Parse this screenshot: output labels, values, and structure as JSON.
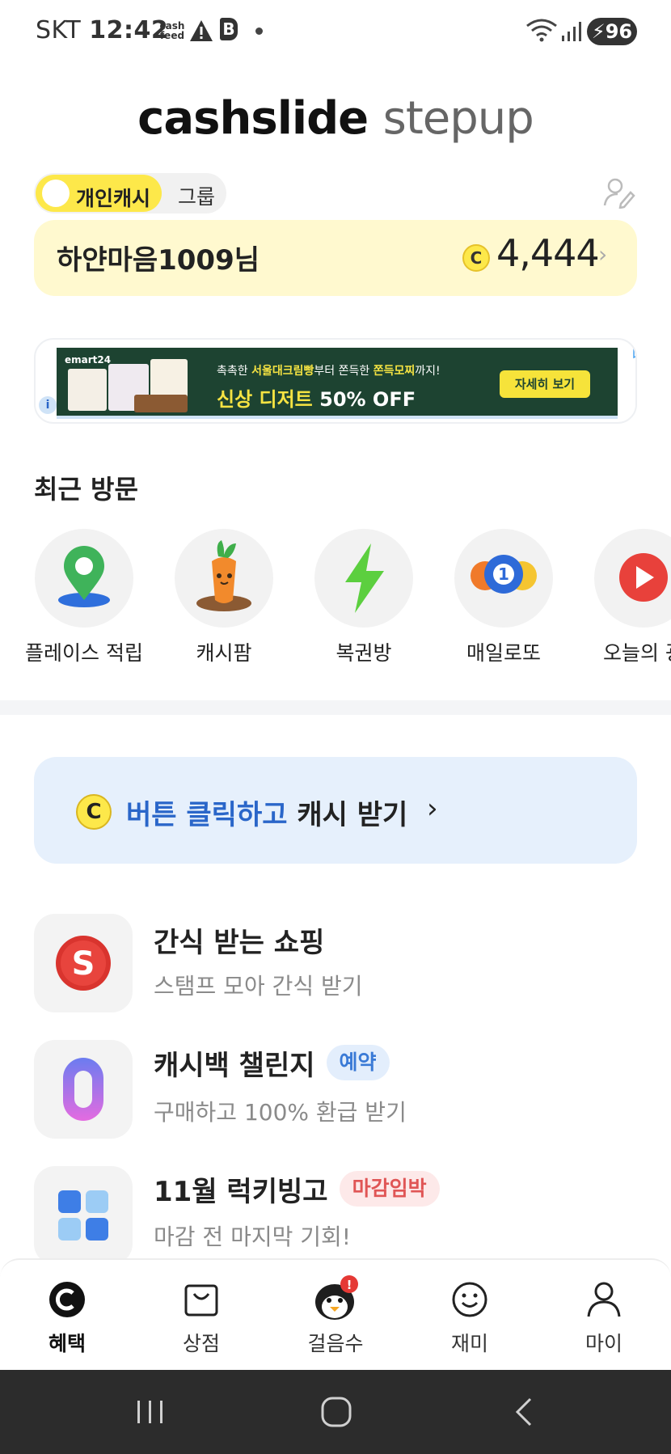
{
  "status_bar": {
    "carrier": "SKT",
    "time": "12:42",
    "cashfeed_line1": "cash",
    "cashfeed_line2": "feed",
    "b_icon": "B",
    "battery": "96"
  },
  "logo": {
    "part1": "cashslide",
    "part2": "stepup"
  },
  "toggle": {
    "personal": "개인캐시",
    "group": "그룹"
  },
  "cash_card": {
    "name": "하얀마음1009님",
    "coin": "C",
    "amount": "4,444"
  },
  "ad": {
    "brand": "emart24",
    "line1_a": "촉촉한 ",
    "line1_b": "서울대크림빵",
    "line1_c": "부터 쫀득한 ",
    "line1_d": "쫀득모찌",
    "line1_e": "까지!",
    "line2_a": "신상 디저트",
    "line2_b": " 50% OFF",
    "button": "자세히 보기",
    "info": "i"
  },
  "recent": {
    "title": "최근 방문",
    "items": [
      {
        "label": "플레이스 적립",
        "icon": "map-pin-icon"
      },
      {
        "label": "캐시팜",
        "icon": "carrot-icon"
      },
      {
        "label": "복권방",
        "icon": "lightning-icon"
      },
      {
        "label": "매일로또",
        "icon": "lotto-balls-icon",
        "ball": "1"
      },
      {
        "label": "오늘의 광",
        "icon": "play-icon"
      }
    ]
  },
  "cash_button": {
    "coin": "C",
    "blue": "버튼 클릭하고",
    "dark": " 캐시 받기",
    "chevron": "›"
  },
  "list": [
    {
      "title": "간식 받는 쇼핑",
      "sub": "스탬프 모아 간식 받기",
      "icon_letter": "S"
    },
    {
      "title": "캐시백 챌린지",
      "badge": "예약",
      "sub": "구매하고 100% 환급 받기",
      "icon_letter": "0"
    },
    {
      "title": "11월 럭키빙고",
      "badge": "마감임박",
      "sub": "마감 전 마지막 기회!"
    }
  ],
  "nav": [
    {
      "label": "혜택",
      "icon": "coin-c-icon"
    },
    {
      "label": "상점",
      "icon": "shopping-bag-icon"
    },
    {
      "label": "걸음수",
      "icon": "penguin-icon",
      "alert": "!"
    },
    {
      "label": "재미",
      "icon": "smile-icon"
    },
    {
      "label": "마이",
      "icon": "person-icon"
    }
  ],
  "colors": {
    "accent_yellow": "#fde84a",
    "blue": "#2a66c9",
    "card_yellow": "#fff9cf",
    "button_blue_bg": "#e6f0fc"
  }
}
